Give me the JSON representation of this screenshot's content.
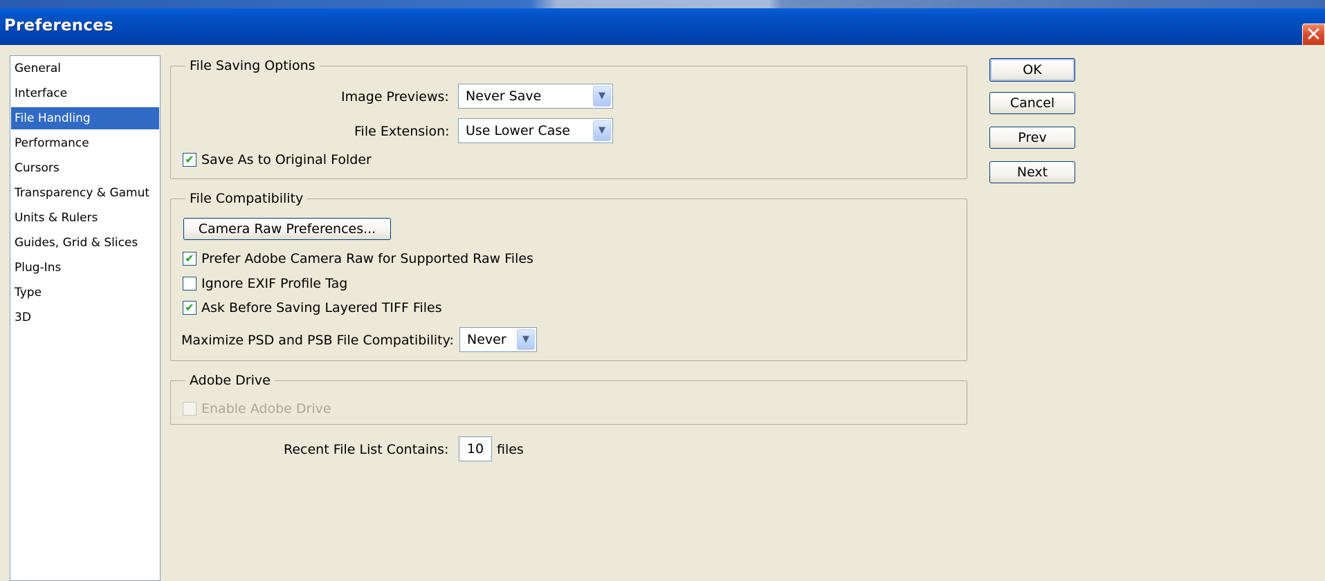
{
  "window": {
    "title": "Preferences",
    "close_glyph": "✕"
  },
  "categories": [
    {
      "label": "General",
      "selected": false
    },
    {
      "label": "Interface",
      "selected": false
    },
    {
      "label": "File Handling",
      "selected": true
    },
    {
      "label": "Performance",
      "selected": false
    },
    {
      "label": "Cursors",
      "selected": false
    },
    {
      "label": "Transparency & Gamut",
      "selected": false
    },
    {
      "label": "Units & Rulers",
      "selected": false
    },
    {
      "label": "Guides, Grid & Slices",
      "selected": false
    },
    {
      "label": "Plug-Ins",
      "selected": false
    },
    {
      "label": "Type",
      "selected": false
    },
    {
      "label": "3D",
      "selected": false
    }
  ],
  "file_saving": {
    "legend": "File Saving Options",
    "image_previews_label": "Image Previews:",
    "image_previews_value": "Never Save",
    "file_extension_label": "File Extension:",
    "file_extension_value": "Use Lower Case",
    "save_as_original_label": "Save As to Original Folder",
    "save_as_original_checked": true
  },
  "file_compat": {
    "legend": "File Compatibility",
    "camera_raw_button": "Camera Raw Preferences...",
    "prefer_acr_label": "Prefer Adobe Camera Raw for Supported Raw Files",
    "prefer_acr_checked": true,
    "ignore_exif_label": "Ignore EXIF Profile Tag",
    "ignore_exif_checked": false,
    "ask_tiff_label": "Ask Before Saving Layered TIFF Files",
    "ask_tiff_checked": true,
    "maximize_label": "Maximize PSD and PSB File Compatibility:",
    "maximize_value": "Never"
  },
  "adobe_drive": {
    "legend": "Adobe Drive",
    "enable_label": "Enable Adobe Drive",
    "enable_checked": false,
    "enabled": false
  },
  "recent": {
    "label": "Recent File List Contains:",
    "value": "10",
    "suffix": "files"
  },
  "buttons": {
    "ok": "OK",
    "cancel": "Cancel",
    "prev": "Prev",
    "next": "Next"
  },
  "dropdown_glyph": "▼",
  "check_glyph": "✔",
  "colors": {
    "title_bar": "#0148b8",
    "selection": "#316ac5",
    "dialog_bg": "#ece9d8",
    "close_button": "#d9482a"
  }
}
